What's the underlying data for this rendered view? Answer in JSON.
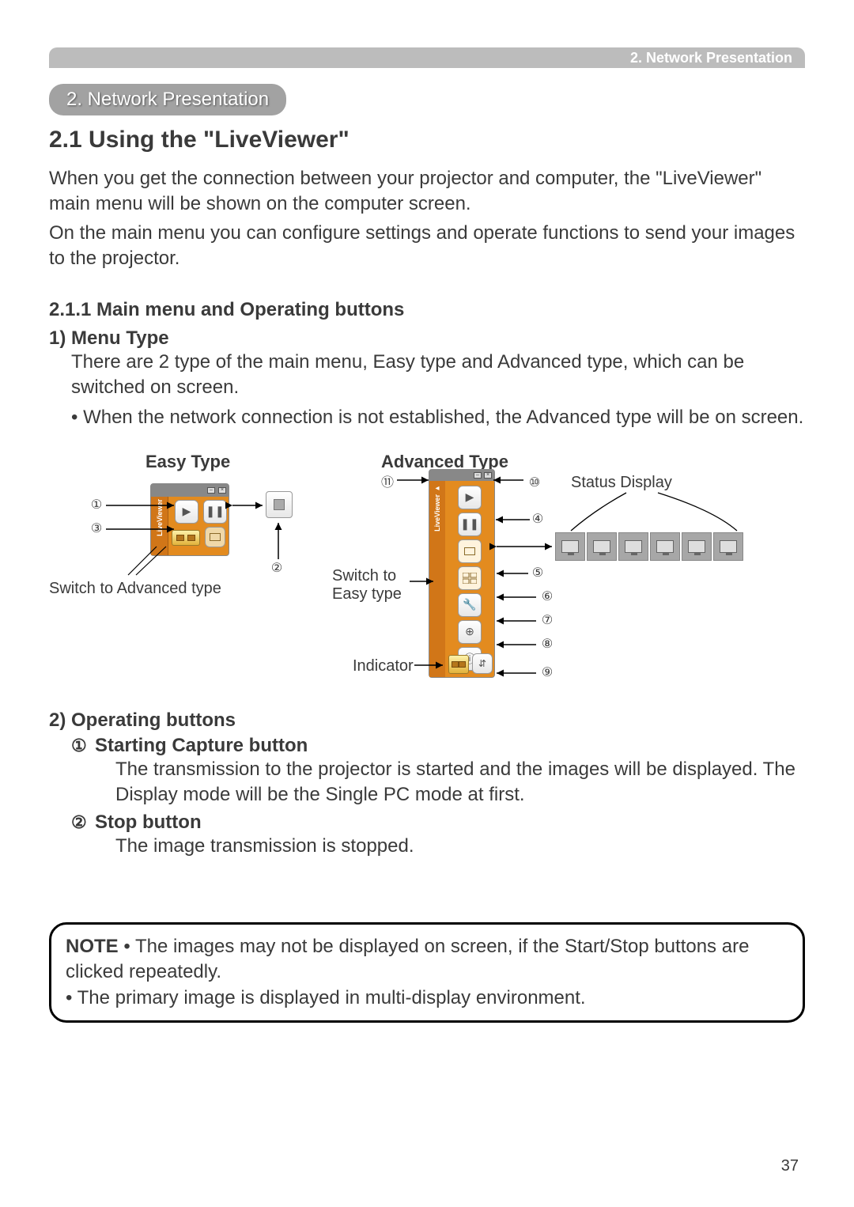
{
  "header": {
    "breadcrumb": "2. Network Presentation"
  },
  "chapter": {
    "label": "2. Network Presentation"
  },
  "section": {
    "title": "2.1 Using the \"LiveViewer\""
  },
  "intro": {
    "p1": "When you get the connection between your projector and computer, the \"LiveViewer\" main menu will be shown on the computer screen.",
    "p2": "On the main menu you can configure settings and operate functions to send your images to the projector."
  },
  "sub": {
    "title": "2.1.1 Main menu and Operating buttons"
  },
  "menutype": {
    "head": "1) Menu Type",
    "desc": "There are 2 type of the main menu, Easy type and Advanced type, which can be switched on screen.",
    "bullet": "• When the network connection is not established, the Advanced type will be on screen."
  },
  "diagram": {
    "easy_label": "Easy Type",
    "advanced_label": "Advanced Type",
    "switch_to_advanced": "Switch to Advanced type",
    "switch_to_easy": "Switch to Easy type",
    "indicator": "Indicator",
    "status_display": "Status Display",
    "widget_brand": "LiveViewer",
    "callouts": {
      "c1": "①",
      "c2": "②",
      "c3": "③",
      "c4": "④",
      "c5": "⑤",
      "c6": "⑥",
      "c7": "⑦",
      "c8": "⑧",
      "c9": "⑨",
      "c10": "⑩",
      "c11": "⑪"
    }
  },
  "operating": {
    "head": "2) Operating buttons",
    "items": [
      {
        "num": "①",
        "title": "Starting Capture button",
        "desc": "The transmission to the projector is started and the images will be displayed. The Display mode will be the Single PC mode at first."
      },
      {
        "num": "②",
        "title": "Stop button",
        "desc": "The image transmission is stopped."
      }
    ]
  },
  "note": {
    "label": "NOTE",
    "l1": " • The images may not be displayed on screen, if the Start/Stop buttons are clicked repeatedly.",
    "l2": "• The primary image is displayed in multi-display environment."
  },
  "page": {
    "num": "37"
  }
}
